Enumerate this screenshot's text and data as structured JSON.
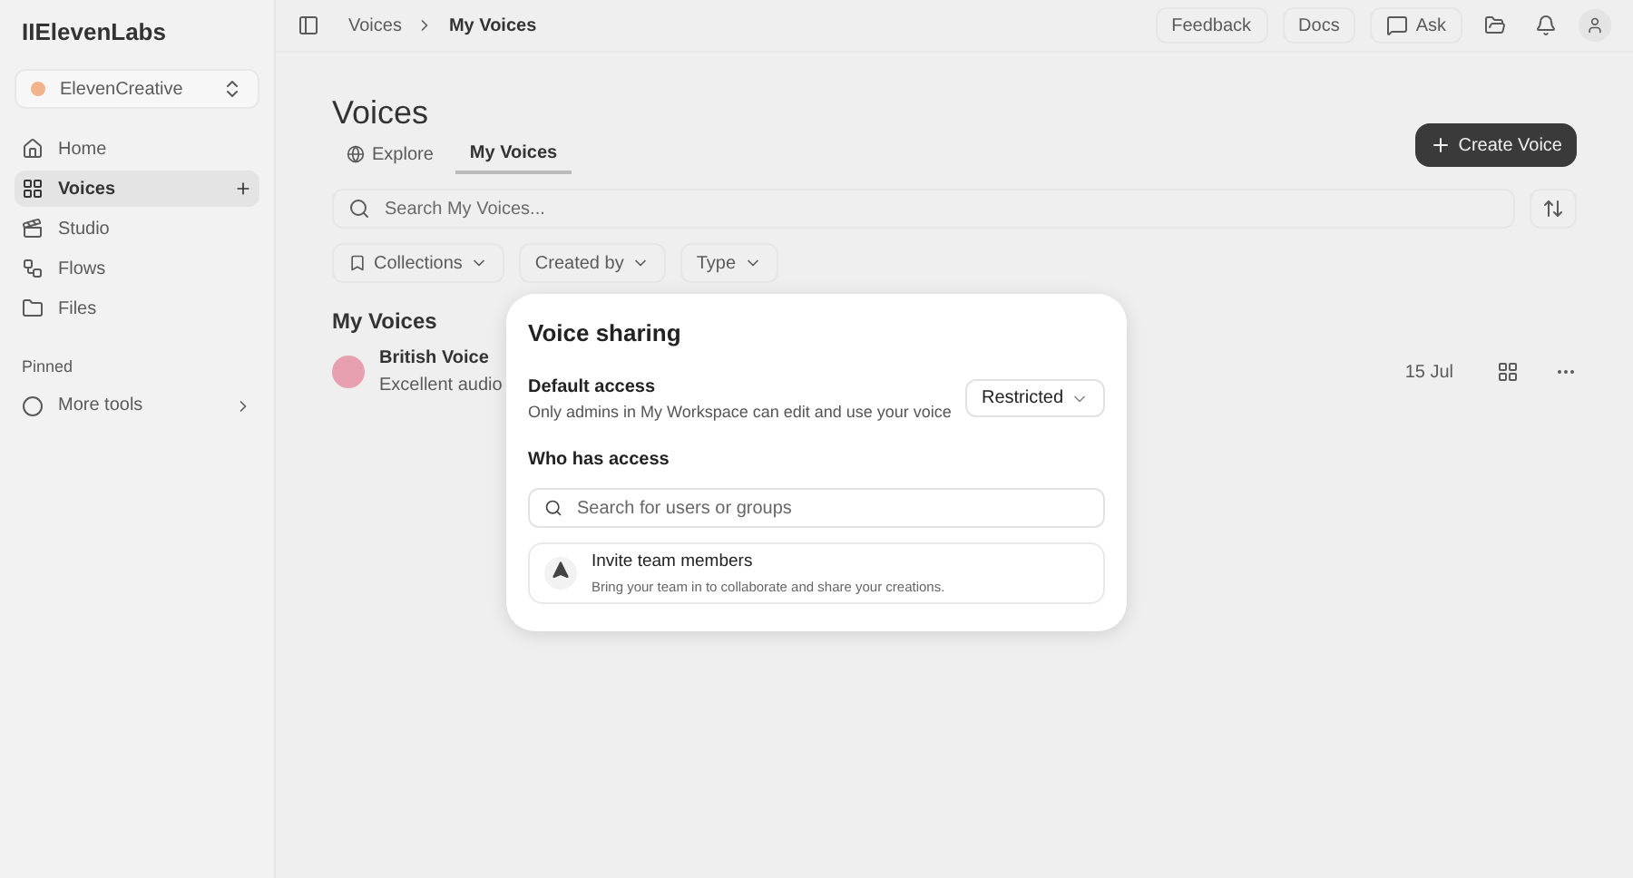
{
  "sidebar": {
    "logo": "IIElevenLabs",
    "workspace": "ElevenCreative",
    "items": [
      {
        "label": "Home",
        "selected": false
      },
      {
        "label": "Voices",
        "selected": true
      },
      {
        "label": "Studio",
        "selected": false
      },
      {
        "label": "Flows",
        "selected": false
      },
      {
        "label": "Files",
        "selected": false
      }
    ],
    "pinned_heading": "Pinned",
    "more_tools": "More tools"
  },
  "topbar": {
    "breadcrumbs": [
      "Voices",
      "My Voices"
    ],
    "buttons": [
      "Feedback",
      "Docs",
      "Ask"
    ]
  },
  "page": {
    "title": "Voices",
    "create_button": "Create Voice",
    "tabs": [
      {
        "label": "Explore",
        "selected": false
      },
      {
        "label": "My Voices",
        "selected": true
      }
    ],
    "search": {
      "placeholder": "Search My Voices..."
    },
    "filters": [
      "Collections",
      "Created by",
      "Type"
    ],
    "section_title": "My Voices",
    "voices": [
      {
        "name": "British Voice",
        "description": "Excellent audio",
        "date": "15 Jul"
      }
    ]
  },
  "dialog": {
    "title": "Voice sharing",
    "default_access_label": "Default access",
    "default_access_text": "Only admins in My Workspace can edit and use your voice",
    "access_select": "Restricted",
    "who_label": "Who has access",
    "search": {
      "placeholder": "Search for users or groups"
    },
    "invite": {
      "title": "Invite team members",
      "text": "Bring your team in to collaborate and share your creations."
    }
  }
}
